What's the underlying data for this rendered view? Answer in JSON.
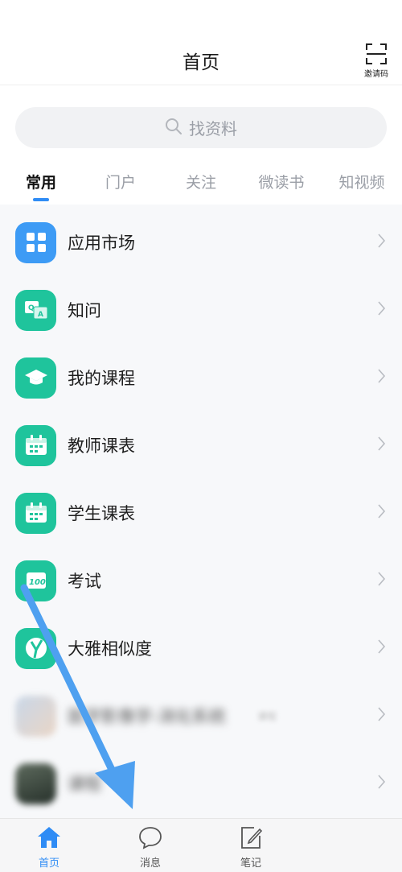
{
  "header": {
    "title": "首页",
    "invite_label": "邀请码"
  },
  "search": {
    "placeholder": "找资料"
  },
  "tabs": [
    {
      "label": "常用",
      "active": true
    },
    {
      "label": "门户",
      "active": false
    },
    {
      "label": "关注",
      "active": false
    },
    {
      "label": "微读书",
      "active": false
    },
    {
      "label": "知视频",
      "active": false
    }
  ],
  "apps": [
    {
      "label": "应用市场",
      "icon": "grid-icon",
      "color": "#3d9bf5"
    },
    {
      "label": "知问",
      "icon": "qa-icon",
      "color": "#1fc49c"
    },
    {
      "label": "我的课程",
      "icon": "graduation-cap-icon",
      "color": "#1fc49c"
    },
    {
      "label": "教师课表",
      "icon": "calendar-icon",
      "color": "#1fc49c"
    },
    {
      "label": "学生课表",
      "icon": "calendar-icon",
      "color": "#1fc49c"
    },
    {
      "label": "考试",
      "icon": "exam-100-icon",
      "color": "#1fc49c"
    },
    {
      "label": "大雅相似度",
      "icon": "similarity-icon",
      "color": "#1fc49c"
    }
  ],
  "blurred_items": [
    {
      "label": "医学影像学-消化系统",
      "sub": "课程"
    },
    {
      "label": "课程",
      "sub": ""
    }
  ],
  "bottom_nav": [
    {
      "label": "首页",
      "icon": "home-icon",
      "active": true
    },
    {
      "label": "消息",
      "icon": "message-icon",
      "active": false
    },
    {
      "label": "笔记",
      "icon": "note-icon",
      "active": false
    }
  ],
  "colors": {
    "accent": "#2f8cf5",
    "app_green": "#1fc49c",
    "annotation_arrow": "#4ea0f0"
  }
}
